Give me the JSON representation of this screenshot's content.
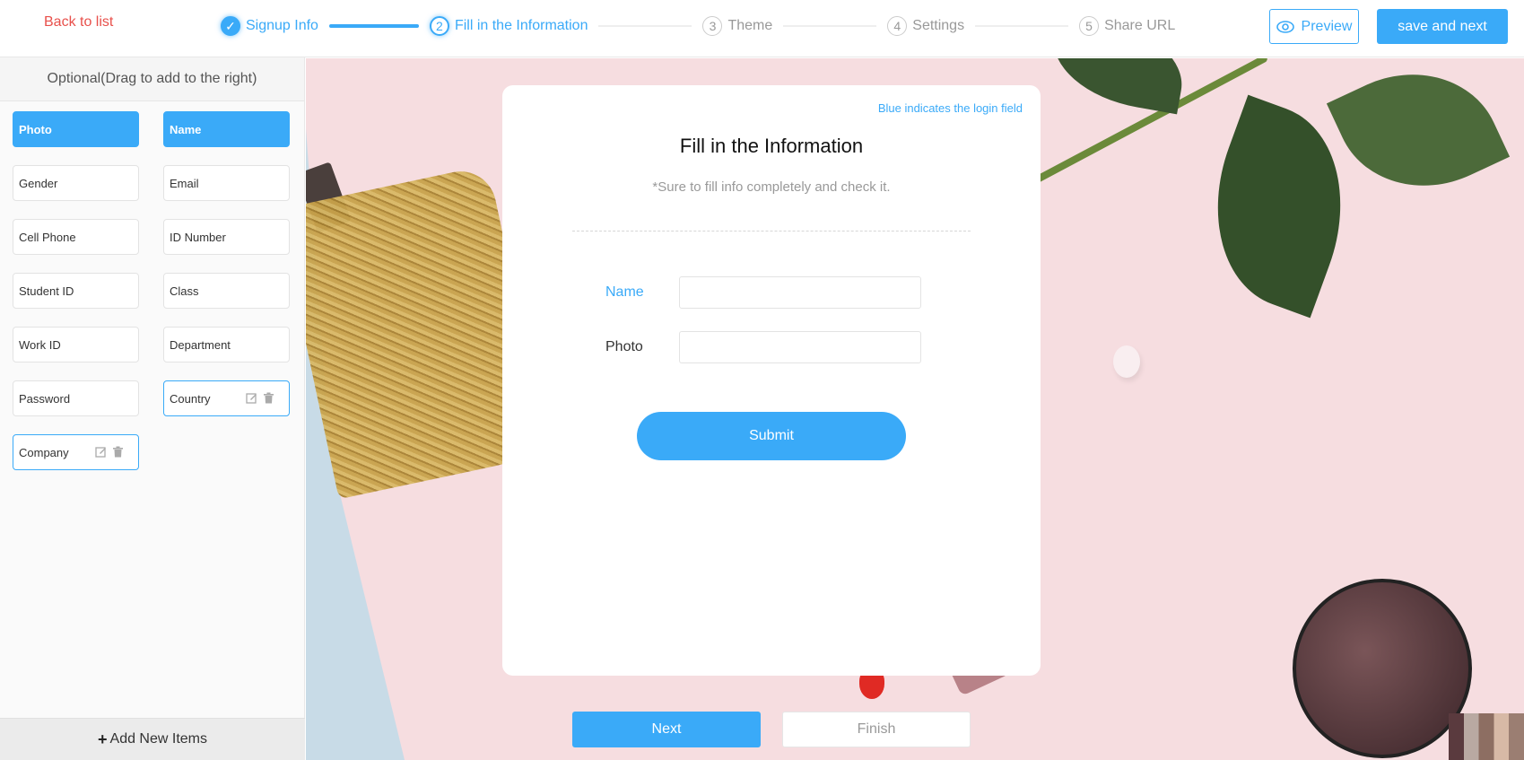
{
  "header": {
    "back_label": "Back to list",
    "steps": [
      {
        "number": "1",
        "label": "Signup Info",
        "state": "done"
      },
      {
        "number": "2",
        "label": "Fill in the Information",
        "state": "active"
      },
      {
        "number": "3",
        "label": "Theme",
        "state": "pending"
      },
      {
        "number": "4",
        "label": "Settings",
        "state": "pending"
      },
      {
        "number": "5",
        "label": "Share URL",
        "state": "pending"
      }
    ],
    "check_glyph": "✓",
    "preview_label": "Preview",
    "save_label": "save and next"
  },
  "sidebar": {
    "title": "Optional(Drag to add to the right)",
    "fields": [
      {
        "label": "Photo",
        "type": "login"
      },
      {
        "label": "Name",
        "type": "login"
      },
      {
        "label": "Gender",
        "type": "default"
      },
      {
        "label": "Email",
        "type": "default"
      },
      {
        "label": "Cell Phone",
        "type": "default"
      },
      {
        "label": "ID Number",
        "type": "default"
      },
      {
        "label": "Student ID",
        "type": "default"
      },
      {
        "label": "Class",
        "type": "default"
      },
      {
        "label": "Work ID",
        "type": "default"
      },
      {
        "label": "Department",
        "type": "default"
      },
      {
        "label": "Password",
        "type": "default"
      },
      {
        "label": "Country",
        "type": "custom"
      },
      {
        "label": "Company",
        "type": "custom"
      }
    ],
    "add_glyph": "+",
    "add_label": "Add New Items"
  },
  "card": {
    "hint": "Blue indicates the login field",
    "title": "Fill in the Information",
    "subtitle": "*Sure to fill info completely and check it.",
    "fields": [
      {
        "label": "Name",
        "value": "",
        "login": true
      },
      {
        "label": "Photo",
        "value": "",
        "login": false
      }
    ],
    "submit_label": "Submit"
  },
  "footer": {
    "next_label": "Next",
    "finish_label": "Finish"
  },
  "colors": {
    "accent": "#3aaaf8",
    "back_link": "#e8504b",
    "canvas_bg": "#f6dde0"
  }
}
